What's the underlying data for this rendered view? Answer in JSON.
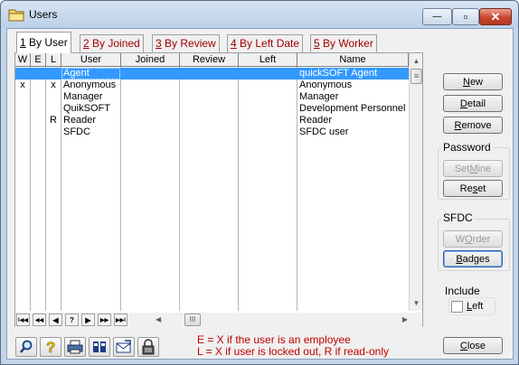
{
  "window": {
    "title": "Users",
    "minimize_glyph": "—",
    "maximize_glyph": "▫",
    "close_glyph": "✕"
  },
  "tabs": [
    {
      "num": "1",
      "label": " By User",
      "active": true
    },
    {
      "num": "2",
      "label": " By Joined",
      "active": false
    },
    {
      "num": "3",
      "label": " By Review",
      "active": false
    },
    {
      "num": "4",
      "label": " By Left Date",
      "active": false
    },
    {
      "num": "5",
      "label": " By Worker",
      "active": false
    }
  ],
  "table": {
    "columns": [
      "W",
      "E",
      "L",
      "User",
      "Joined",
      "Review",
      "Left",
      "Name"
    ],
    "rows": [
      {
        "w": "",
        "e": "",
        "l": "",
        "user": "Agent",
        "joined": "",
        "review": "",
        "left": "",
        "name": "quickSOFT Agent",
        "selected": true
      },
      {
        "w": "x",
        "e": "",
        "l": "x",
        "user": "Anonymous",
        "joined": "",
        "review": "",
        "left": "",
        "name": "Anonymous",
        "selected": false
      },
      {
        "w": "",
        "e": "",
        "l": "",
        "user": "Manager",
        "joined": "",
        "review": "",
        "left": "",
        "name": "Manager",
        "selected": false
      },
      {
        "w": "",
        "e": "",
        "l": "",
        "user": "QuikSOFT",
        "joined": "",
        "review": "",
        "left": "",
        "name": "Development Personnel",
        "selected": false
      },
      {
        "w": "",
        "e": "",
        "l": "R",
        "user": "Reader",
        "joined": "",
        "review": "",
        "left": "",
        "name": "Reader",
        "selected": false
      },
      {
        "w": "",
        "e": "",
        "l": "",
        "user": "SFDC",
        "joined": "",
        "review": "",
        "left": "",
        "name": "SFDC user",
        "selected": false
      }
    ]
  },
  "navigator": {
    "first": "I◀◀",
    "prev_page": "◀◀",
    "prev": "◀",
    "find": "?",
    "next": "▶",
    "next_page": "▶▶",
    "last": "▶▶I",
    "scroll_left": "◀",
    "scroll_right": "▶",
    "thumb": "III"
  },
  "scrollbar": {
    "up": "▲",
    "down": "▼",
    "thumb": "≡"
  },
  "buttons": {
    "new": {
      "pre": "",
      "u": "N",
      "post": "ew"
    },
    "detail": {
      "pre": "",
      "u": "D",
      "post": "etail"
    },
    "remove": {
      "pre": "",
      "u": "R",
      "post": "emove"
    },
    "set_mine": {
      "pre": "Set ",
      "u": "M",
      "post": "ine"
    },
    "reset": {
      "pre": "Re",
      "u": "s",
      "post": "et"
    },
    "worder": {
      "pre": "W",
      "u": "O",
      "post": "rder"
    },
    "badges": {
      "pre": "",
      "u": "B",
      "post": "adges"
    },
    "close": {
      "pre": "",
      "u": "C",
      "post": "lose"
    }
  },
  "groups": {
    "password": "Password",
    "sfdc": "SFDC",
    "include": "Include",
    "left_check": {
      "u": "L",
      "post": "eft",
      "checked": false
    }
  },
  "legend": {
    "line1": "E = X if the user is an employee",
    "line2": "L = X if user is locked out, R if read-only"
  },
  "colors": {
    "selection": "#3399ff",
    "legend": "#c00000",
    "tab_text": "#a00000"
  }
}
